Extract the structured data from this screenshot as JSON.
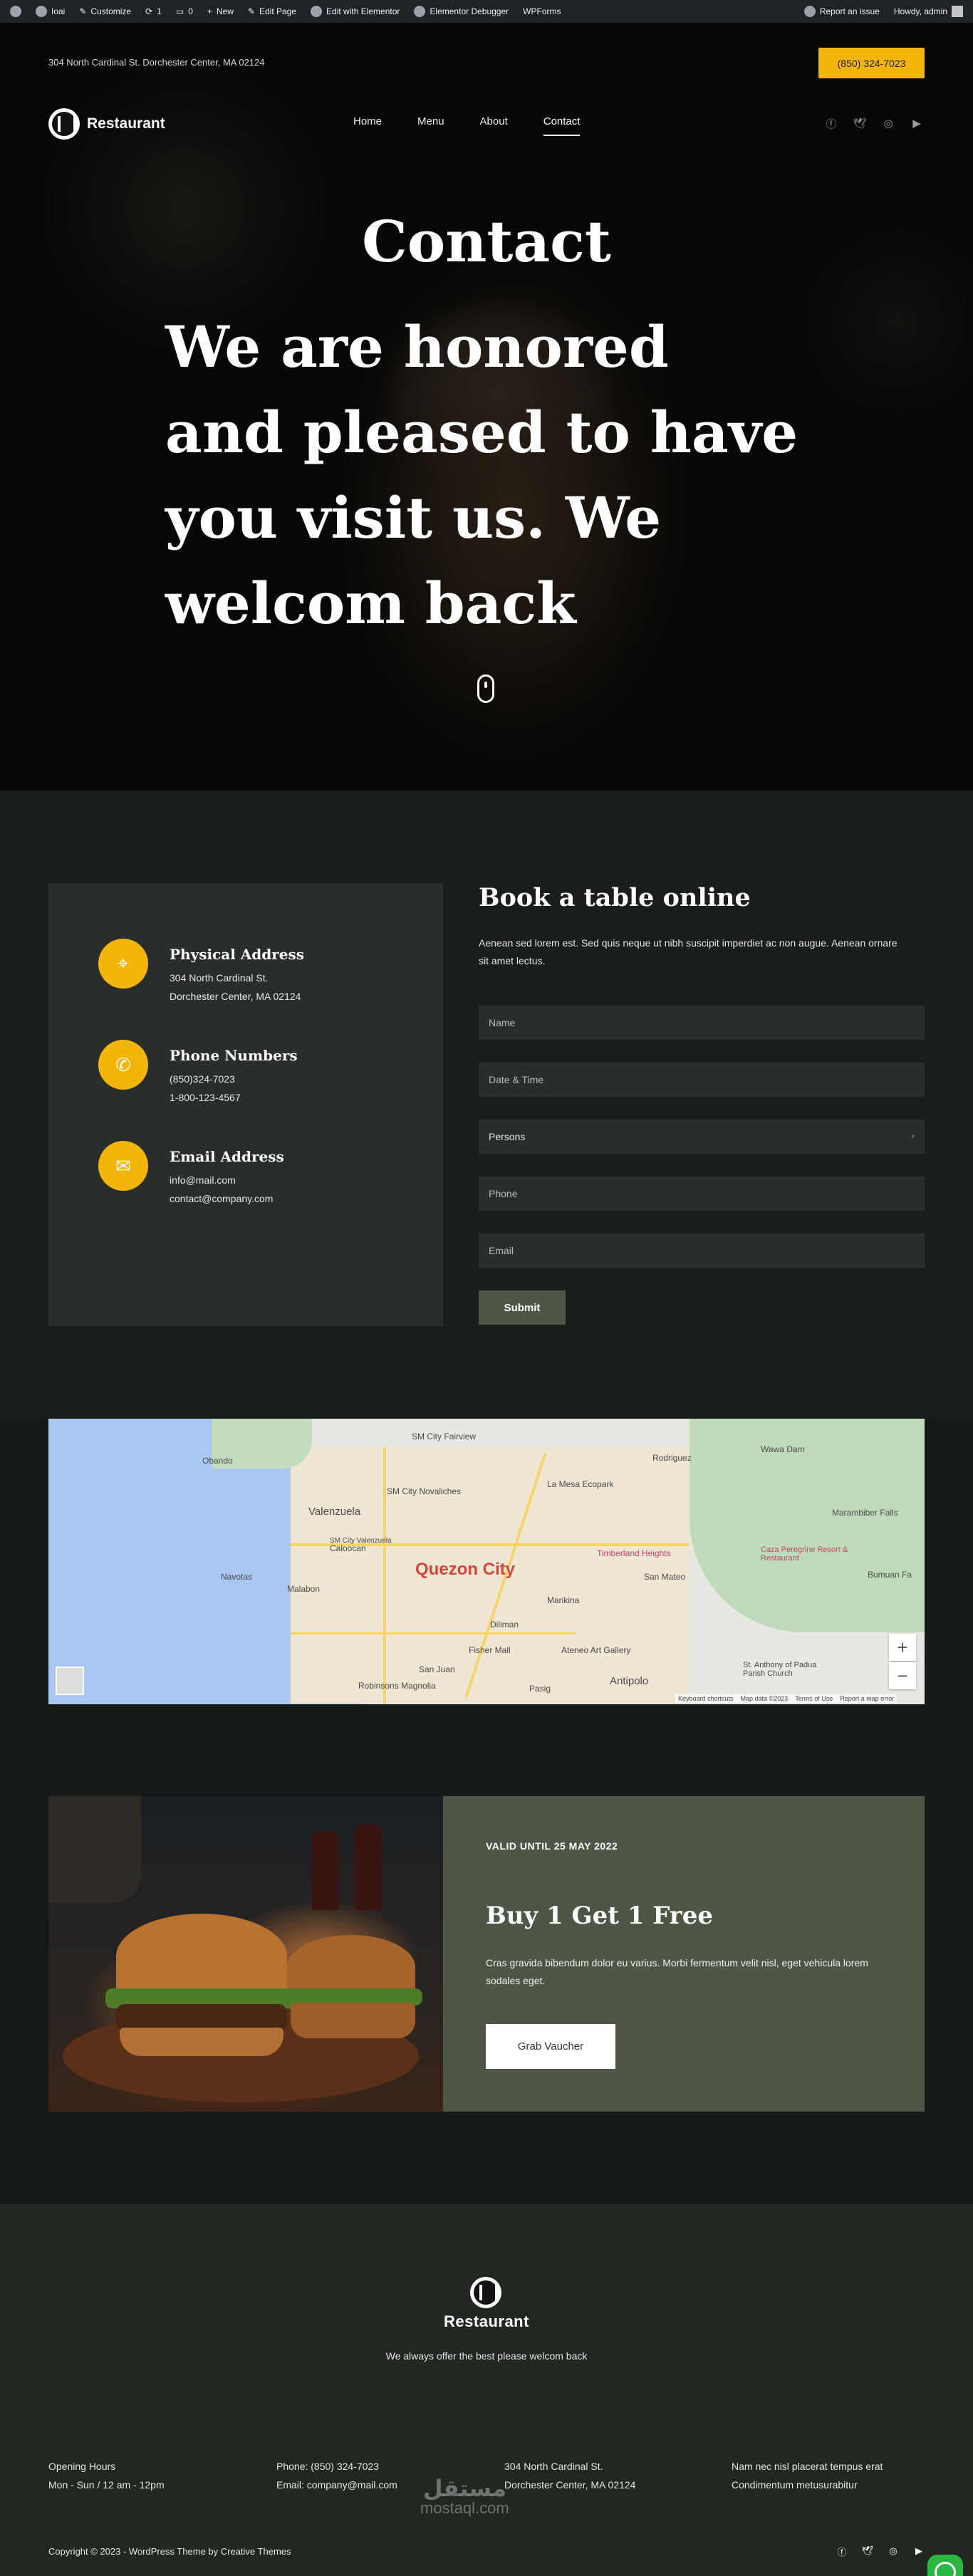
{
  "adminbar": {
    "left": [
      "Ioai",
      "Customize",
      "1",
      "0",
      "New",
      "Edit Page",
      "Edit with Elementor",
      "Elementor Debugger",
      "WPForms"
    ],
    "report": "Report an issue",
    "howdy": "Howdy, admin"
  },
  "header": {
    "address": "304 North Cardinal St. Dorchester Center, MA 02124",
    "phone": "(850) 324-7023",
    "brand": "Restaurant",
    "nav": [
      "Home",
      "Menu",
      "About",
      "Contact"
    ],
    "active_nav": "Contact"
  },
  "hero": {
    "title": "Contact",
    "subtitle": "We are honored and pleased to have you visit us. We welcom back"
  },
  "contact_info": [
    {
      "title": "Physical Address",
      "lines": [
        "304 North Cardinal St.",
        "Dorchester Center, MA 02124"
      ],
      "icon": "location-pin-icon"
    },
    {
      "title": "Phone Numbers",
      "lines": [
        "(850)324-7023",
        "1-800-123-4567"
      ],
      "icon": "phone-icon"
    },
    {
      "title": "Email Address",
      "lines": [
        "info@mail.com",
        "contact@company.com"
      ],
      "icon": "envelope-icon"
    }
  ],
  "booking": {
    "title": "Book a table online",
    "description": "Aenean sed lorem est. Sed quis neque ut nibh suscipit imperdiet ac non augue. Aenean ornare sit amet lectus.",
    "name_placeholder": "Name",
    "datetime_placeholder": "Date & Time",
    "persons_label": "Persons",
    "phone_placeholder": "Phone",
    "email_placeholder": "Email",
    "submit_label": "Submit"
  },
  "map": {
    "city": "Quezon City",
    "labels": [
      "Obando",
      "Valenzuela",
      "Navotas",
      "Malabon",
      "Rodriguez",
      "San Mateo",
      "Antipolo",
      "Marikina",
      "Caloocan",
      "Wawa Dam",
      "Timberland Heights",
      "Fisher Mall",
      "Ateneo Art Gallery",
      "SM City Fairview",
      "SM City Valenzuela",
      "SM City Novaliches",
      "Diliman",
      "San Juan",
      "Robinsons Magnolia",
      "La Mesa Ecopark",
      "Pasig",
      "Marambiber Falls",
      "Bumuan Fa",
      "Caza Peregrine Resort & Restaurant",
      "St. Anthony of Padua Parish Church"
    ],
    "attribution": [
      "Keyboard shortcuts",
      "Map data ©2023",
      "Terms of Use",
      "Report a map error"
    ]
  },
  "promo": {
    "valid": "VALID UNTIL 25 MAY 2022",
    "title": "Buy 1 Get 1 Free",
    "description": "Cras gravida bibendum dolor eu varius. Morbi fermentum velit nisl, eget vehicula lorem sodales eget.",
    "button": "Grab Vaucher"
  },
  "footer": {
    "brand": "Restaurant",
    "tagline": "We always offer the best please welcom back",
    "col1": [
      "Opening Hours",
      "Mon - Sun / 12 am - 12pm"
    ],
    "col2": [
      "Phone: (850) 324-7023",
      "Email: company@mail.com"
    ],
    "col3": [
      "304 North Cardinal St.",
      "Dorchester Center, MA 02124"
    ],
    "col4": [
      "Nam nec nisl placerat tempus erat",
      "Condimentum metusurabitur"
    ],
    "copyright": "Copyright © 2023 - WordPress Theme by Creative Themes",
    "watermark_arabic": "مستقل",
    "watermark_latin": "mostaql.com"
  },
  "colors": {
    "accent": "#f3b50a",
    "olive": "#4e5745",
    "dark": "#1a1e1b"
  }
}
